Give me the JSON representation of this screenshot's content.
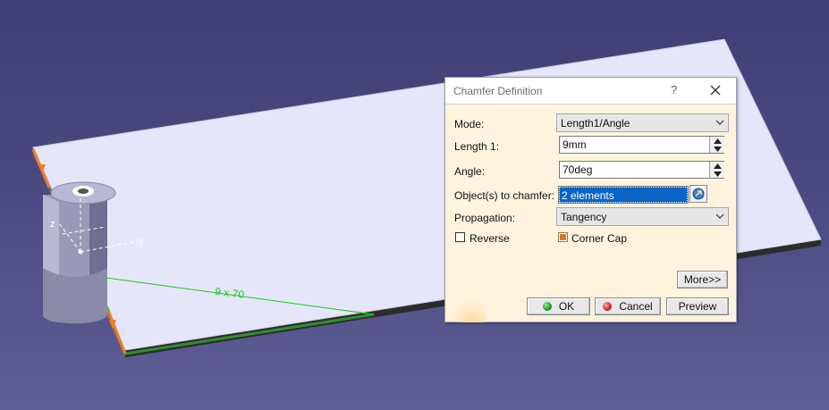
{
  "viewport": {
    "dimension_text": "9 x 70",
    "axis_z_label": "z",
    "axis_y_label": "y",
    "background_top": "#3f3f75",
    "background_bottom": "#5e5e96",
    "plate_color": "#e6e6fa",
    "highlight_color": "#f07d1e",
    "dimension_color": "#1ec81e"
  },
  "dialog": {
    "title": "Chamfer Definition",
    "help_label": "?",
    "mode": {
      "label": "Mode:",
      "value": "Length1/Angle"
    },
    "length1": {
      "label": "Length 1:",
      "value": "9mm"
    },
    "angle": {
      "label": "Angle:",
      "value": "70deg"
    },
    "objects": {
      "label": "Object(s) to chamfer:",
      "value": "2 elements"
    },
    "propagation": {
      "label": "Propagation:",
      "value": "Tangency"
    },
    "reverse": {
      "label": "Reverse",
      "checked": false
    },
    "corner_cap": {
      "label": "Corner Cap",
      "checked": true
    },
    "buttons": {
      "more": "More>>",
      "ok": "OK",
      "cancel": "Cancel",
      "preview": "Preview"
    },
    "selection_color": "#0a64c8",
    "dialog_bg": "#fff3de"
  }
}
